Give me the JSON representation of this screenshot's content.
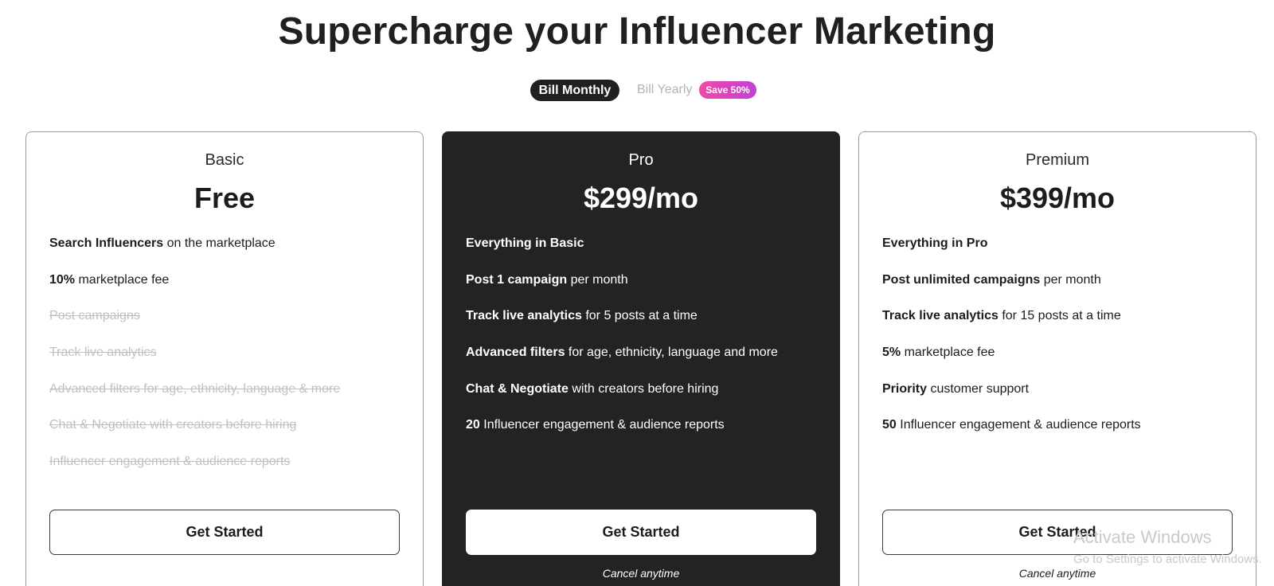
{
  "headline": "Supercharge your Influencer Marketing",
  "billing": {
    "monthly_label": "Bill Monthly",
    "yearly_label": "Bill Yearly",
    "save_badge": "Save 50%",
    "selected": "monthly",
    "badge_gradient": [
      "#f04aa6",
      "#c23fd6"
    ]
  },
  "plans": [
    {
      "name": "Basic",
      "price": "Free",
      "features": [
        {
          "bold": "Search Influencers",
          "text": " on the marketplace",
          "enabled": true
        },
        {
          "bold": "10%",
          "text": " marketplace fee",
          "enabled": true
        },
        {
          "bold": "",
          "text": "Post campaigns",
          "enabled": false
        },
        {
          "bold": "",
          "text": "Track live analytics",
          "enabled": false
        },
        {
          "bold": "",
          "text": "Advanced filters for age, ethnicity, language & more",
          "enabled": false
        },
        {
          "bold": "",
          "text": "Chat & Negotiate with creators before hiring",
          "enabled": false
        },
        {
          "bold": "",
          "text": "Influencer engagement & audience reports",
          "enabled": false
        }
      ],
      "cta": "Get Started",
      "cancel_note": ""
    },
    {
      "name": "Pro",
      "price": "$299/mo",
      "highlighted": true,
      "features": [
        {
          "bold": "Everything in Basic",
          "text": "",
          "enabled": true
        },
        {
          "bold": "Post 1 campaign",
          "text": " per month",
          "enabled": true
        },
        {
          "bold": "Track live analytics",
          "text": " for 5 posts at a time",
          "enabled": true
        },
        {
          "bold": "Advanced filters",
          "text": " for age, ethnicity, language and more",
          "enabled": true
        },
        {
          "bold": "Chat & Negotiate",
          "text": " with creators before hiring",
          "enabled": true
        },
        {
          "bold": "20",
          "text": " Influencer engagement & audience reports",
          "enabled": true
        }
      ],
      "cta": "Get Started",
      "cancel_note": "Cancel anytime"
    },
    {
      "name": "Premium",
      "price": "$399/mo",
      "features": [
        {
          "bold": "Everything in Pro",
          "text": "",
          "enabled": true
        },
        {
          "bold": "Post unlimited campaigns",
          "text": " per month",
          "enabled": true
        },
        {
          "bold": "Track live analytics",
          "text": " for 15 posts at a time",
          "enabled": true
        },
        {
          "bold": "5%",
          "text": " marketplace fee",
          "enabled": true
        },
        {
          "bold": "Priority",
          "text": " customer support",
          "enabled": true
        },
        {
          "bold": "50",
          "text": " Influencer engagement & audience reports",
          "enabled": true
        }
      ],
      "cta": "Get Started",
      "cancel_note": "Cancel anytime"
    }
  ],
  "os_watermark": {
    "title": "Activate Windows",
    "subtitle": "Go to Settings to activate Windows."
  },
  "colors": {
    "dark_card": "#232323",
    "text": "#1c1c1c",
    "disabled_text": "#c0c0c0"
  }
}
